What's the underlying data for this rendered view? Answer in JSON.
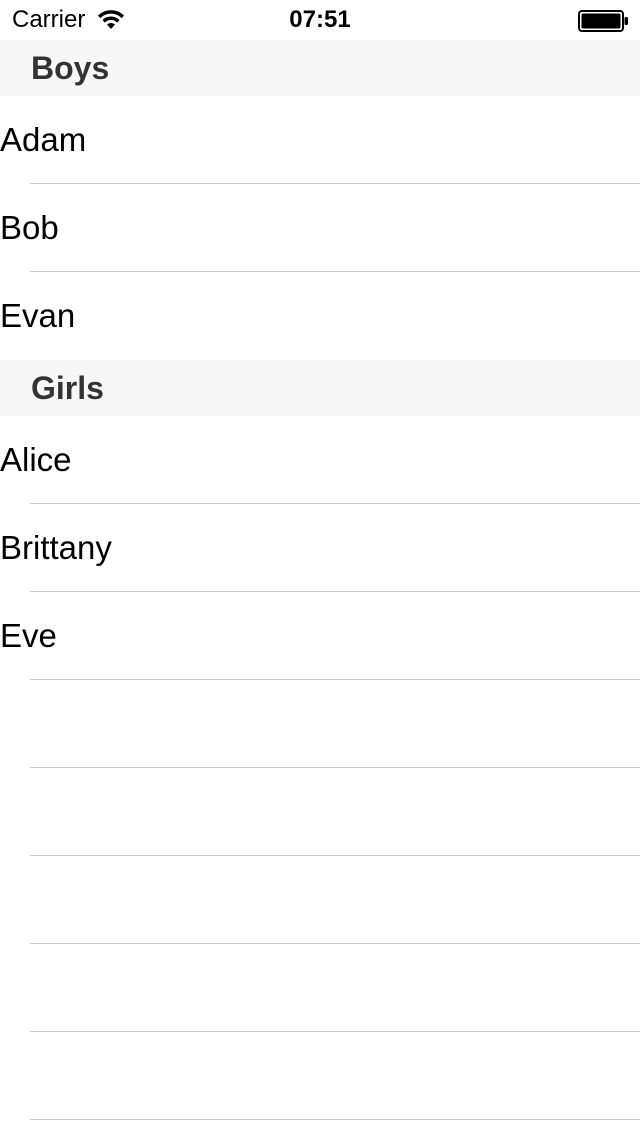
{
  "status_bar": {
    "carrier": "Carrier",
    "time": "07:51",
    "wifi_icon": "wifi-icon",
    "battery_icon": "battery-icon"
  },
  "sections": [
    {
      "title": "Boys",
      "rows": [
        "Adam",
        "Bob",
        "Evan"
      ]
    },
    {
      "title": "Girls",
      "rows": [
        "Alice",
        "Brittany",
        "Eve"
      ]
    }
  ],
  "colors": {
    "section_header_bg": "#f7f7f7",
    "separator": "#c8c7cc",
    "section_title": "#333333"
  }
}
